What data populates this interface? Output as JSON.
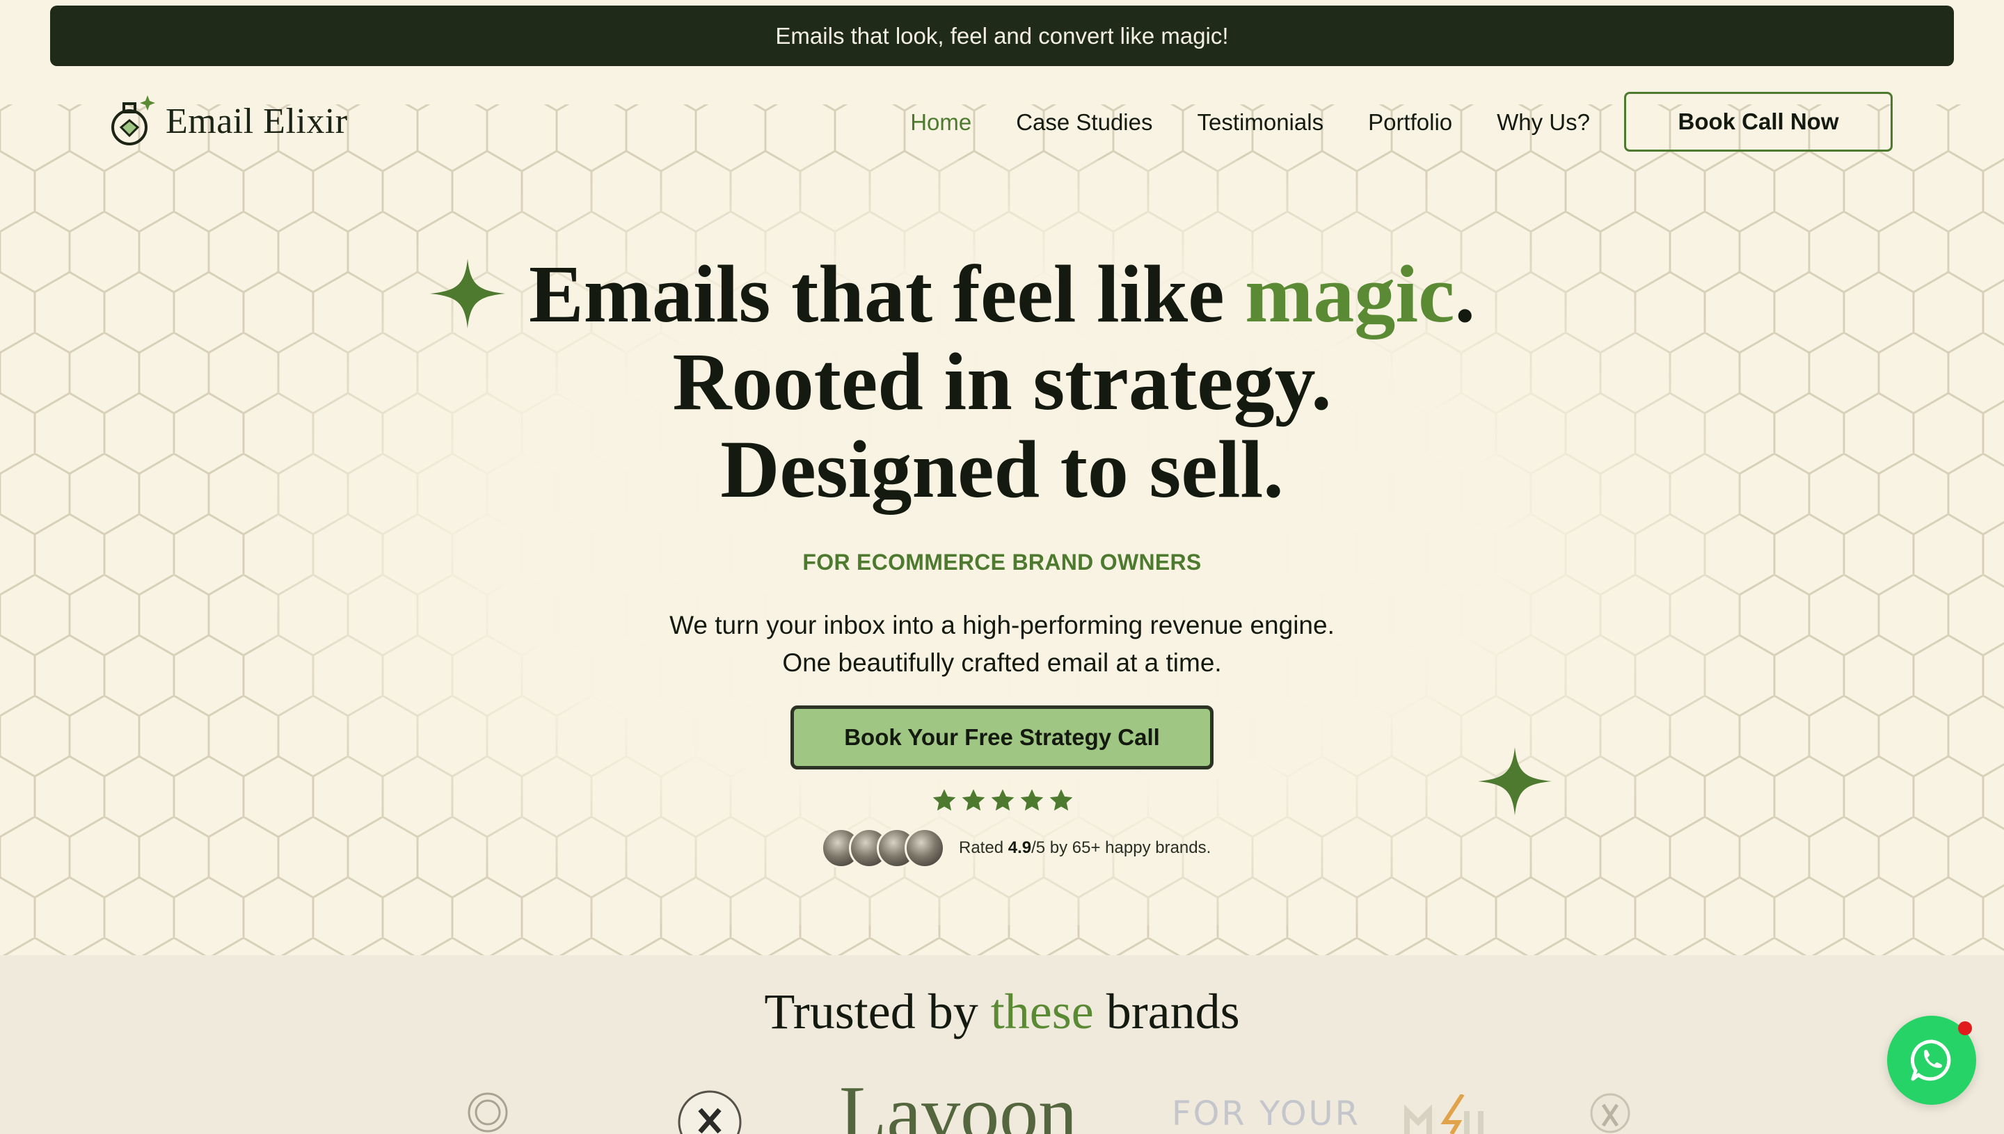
{
  "announcement": "Emails that look, feel and convert like magic!",
  "brand": {
    "name": "Email Elixir",
    "logo_icon": "potion-bottle-icon"
  },
  "nav": {
    "links": [
      {
        "label": "Home",
        "active": true
      },
      {
        "label": "Case Studies"
      },
      {
        "label": "Testimonials"
      },
      {
        "label": "Portfolio"
      },
      {
        "label": "Why Us?"
      }
    ],
    "cta": "Book Call Now"
  },
  "hero": {
    "line1_pre": "Emails that feel like ",
    "line1_accent": "magic",
    "line1_post": ".",
    "line2": "Rooted in strategy.",
    "line3": "Designed to sell.",
    "tagline": "FOR ECOMMERCE BRAND OWNERS",
    "sub1": "We turn your inbox into a high-performing revenue engine.",
    "sub2": "One beautifully crafted email at a time.",
    "cta": "Book Your Free Strategy Call",
    "stars": 5,
    "rating_pre": "Rated ",
    "rating_value": "4.9",
    "rating_post": "/5 by 65+ happy brands."
  },
  "trusted": {
    "pre": "Trusted by ",
    "accent": "these",
    "post": " brands",
    "logos": [
      "Lavoon",
      "FOR YOUR"
    ]
  },
  "colors": {
    "background": "#f8f3e3",
    "dark_bar": "#1f2a18",
    "accent_green": "#5a8a33",
    "cta_green": "#9fc683",
    "whatsapp": "#25d366"
  },
  "widgets": {
    "chat_icon": "whatsapp-icon"
  }
}
